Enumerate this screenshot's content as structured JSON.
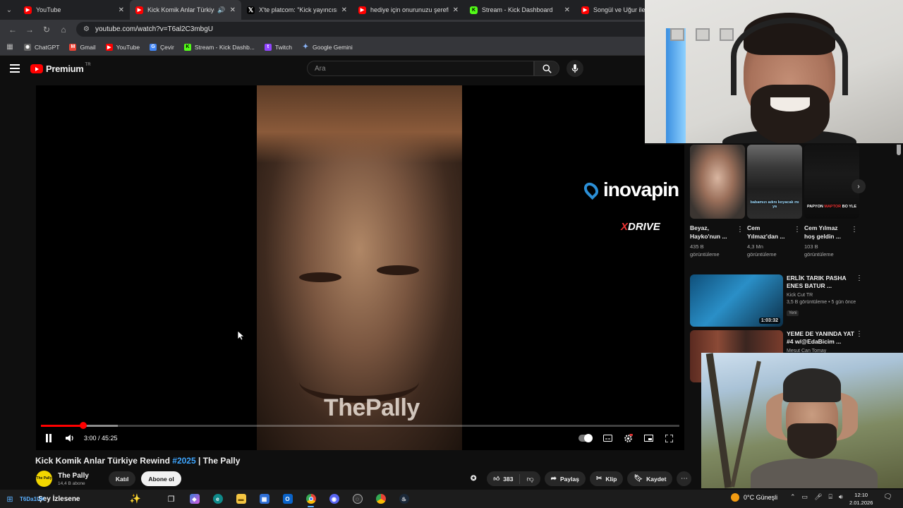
{
  "browser": {
    "tabs": [
      {
        "title": "YouTube",
        "favicon_color": "#ff0000",
        "active": false
      },
      {
        "title": "Kick Komik Anlar Türkiye Rewind",
        "favicon_color": "#ff0000",
        "active": true
      },
      {
        "title": "X'te platcom: \"Kick yayıncısı Ca",
        "favicon_color": "#000000",
        "active": false
      },
      {
        "title": "hediye için onurunuzu şerefiniz",
        "favicon_color": "#ff0000",
        "active": false
      },
      {
        "title": "Stream - Kick Dashboard",
        "favicon_color": "#53fc18",
        "active": false
      },
      {
        "title": "Songül ve Uğur ile S",
        "favicon_color": "#ff0000",
        "active": false
      }
    ],
    "url": "youtube.com/watch?v=T6al2C3mbgU",
    "bookmarks": [
      {
        "label": "ChatGPT",
        "icon": "chatgpt-icon",
        "color": "#bbbbbb"
      },
      {
        "label": "Gmail",
        "icon": "gmail-icon",
        "color": "#ea4335"
      },
      {
        "label": "YouTube",
        "icon": "youtube-icon",
        "color": "#ff0000"
      },
      {
        "label": "Çevir",
        "icon": "translate-icon",
        "color": "#4285f4"
      },
      {
        "label": "Stream - Kick Dashb...",
        "icon": "kick-icon",
        "color": "#53fc18"
      },
      {
        "label": "Twitch",
        "icon": "twitch-icon",
        "color": "#9146ff"
      },
      {
        "label": "Google Gemini",
        "icon": "gemini-icon",
        "color": "#8ab4f8"
      }
    ]
  },
  "youtube": {
    "logo_text": "Premium",
    "logo_region": "TR",
    "search_placeholder": "Ara"
  },
  "player": {
    "time": "3:00 / 45:25",
    "progress": 0.066,
    "buffered": 0.12,
    "watermark": "ThePally",
    "sponsor1": "inovapin",
    "sponsor2_x": "X",
    "sponsor2_rest": "DRIVE"
  },
  "video": {
    "title_prefix": "Kick Komik Anlar Türkiye Rewind ",
    "title_hashtag": "#2025",
    "title_suffix": " | The Pally",
    "channel_name": "The Pally",
    "avatar_text": "The Pally",
    "subscribers": "14,4 B abone",
    "join_label": "Katıl",
    "subscribe_label": "Abone ol",
    "likes": "383",
    "share_label": "Paylaş",
    "clip_label": "Klip",
    "save_label": "Kaydet"
  },
  "shorts": [
    {
      "title": "Beyaz, Hayko'nun ...",
      "views": "435 B görüntüleme",
      "caption": ""
    },
    {
      "title": "Cem Yılmaz'dan ...",
      "views": "4,3 Mn görüntüleme",
      "caption": "babamızı adını koyacak mı ya"
    },
    {
      "title": "Cem Yılmaz hoş geldin ...",
      "views": "103 B görüntüleme",
      "caption_a": "PAPYON ",
      "caption_b": "MAPTOR",
      "caption_c": " BO YLE"
    }
  ],
  "related": [
    {
      "title": "ERLİK TARIK PASHA ENES BATUR ...",
      "channel": "Kick Cut TR",
      "meta": "3,5 B görüntüleme • 5 gün önce",
      "badge": "Yeni",
      "duration": "1:03:32"
    },
    {
      "title": "YEME DE YANINDA YAT #4 w/@EdaBicim ...",
      "channel": "Mesut Can Tomay",
      "meta": "",
      "badge": "",
      "duration": ""
    }
  ],
  "taskbar": {
    "search_text": "Şey İzlesene",
    "search_prefix": "T6Da1UK",
    "weather": "0°C  Güneşli",
    "time": "12:10",
    "date": "2.01.2026"
  }
}
